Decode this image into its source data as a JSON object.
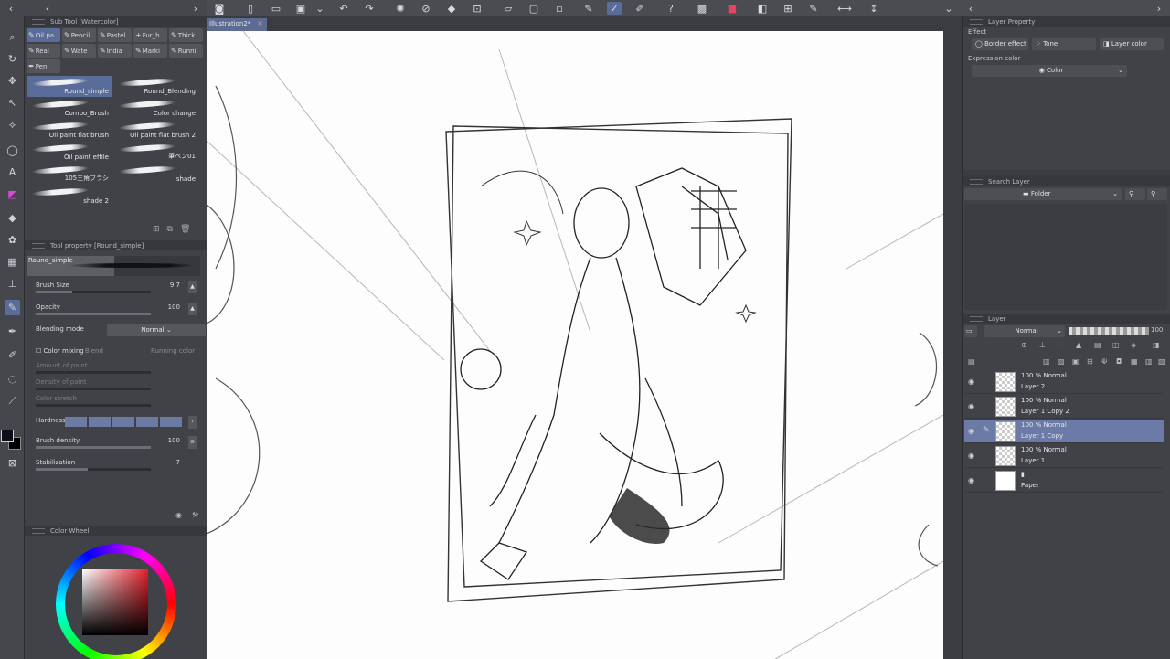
{
  "document": {
    "tab_title": "Illustration2*",
    "close": "×"
  },
  "subtool": {
    "title": "Sub Tool [Watercolor]",
    "categories": [
      "Oil pa",
      "Pencil",
      "Pastel",
      "Fur_b",
      "Thick",
      "Real",
      "Wate",
      "India",
      "Marki",
      "Runni",
      "Pen"
    ],
    "brushes": [
      "Round_simple",
      "Round_Blending",
      "Combo_Brush",
      "Color change",
      "Oil paint flat brush",
      "Oil paint flat brush 2",
      "Oil paint effile",
      "筆ペン01",
      "105三角ブラシ",
      "shade",
      "shade 2"
    ],
    "selected_brush": "Round_simple"
  },
  "tool_property": {
    "title": "Tool property [Round_simple]",
    "preview_name": "Round_simple",
    "brush_size": {
      "label": "Brush Size",
      "value": "9.7",
      "fraction": 0.32
    },
    "opacity": {
      "label": "Opacity",
      "value": "100",
      "fraction": 1.0
    },
    "blending_mode": {
      "label": "Blending mode",
      "value": "Normal"
    },
    "color_mixing": {
      "label": "Color mixing",
      "blend": "Blend",
      "running": "Running color"
    },
    "amount_of_paint": "Amount of paint",
    "density_of_paint": "Density of paint",
    "color_stretch": "Color stretch",
    "hardness": {
      "label": "Hardness"
    },
    "brush_density": {
      "label": "Brush density",
      "value": "100",
      "fraction": 1.0
    },
    "stabilization": {
      "label": "Stabilization",
      "value": "7",
      "fraction": 0.45
    }
  },
  "color_wheel": {
    "title": "Color Wheel",
    "hue_color": "#e3202b"
  },
  "colors": {
    "accent": "#5a6d9a",
    "panel": "#404247",
    "selected_layer": "#6b7aa6"
  },
  "layer_property": {
    "title": "Layer Property",
    "effect_label": "Effect",
    "border_effect": "Border effect",
    "tone": "Tone",
    "layer_color": "Layer color",
    "expression_color_label": "Expression color",
    "expression_color_value": "Color"
  },
  "search_layer": {
    "title": "Search Layer",
    "filter": "Folder"
  },
  "layers": {
    "tab": "Layer",
    "blend_mode": "Normal",
    "opacity": "100",
    "items": [
      {
        "mode": "100 % Normal",
        "name": "Layer 2",
        "selected": false
      },
      {
        "mode": "100 % Normal",
        "name": "Layer 1 Copy 2",
        "selected": false
      },
      {
        "mode": "100 % Normal",
        "name": "Layer 1 Copy",
        "selected": true
      },
      {
        "mode": "100 % Normal",
        "name": "Layer 1",
        "selected": false
      },
      {
        "mode": "",
        "name": "Paper",
        "selected": false
      }
    ]
  }
}
